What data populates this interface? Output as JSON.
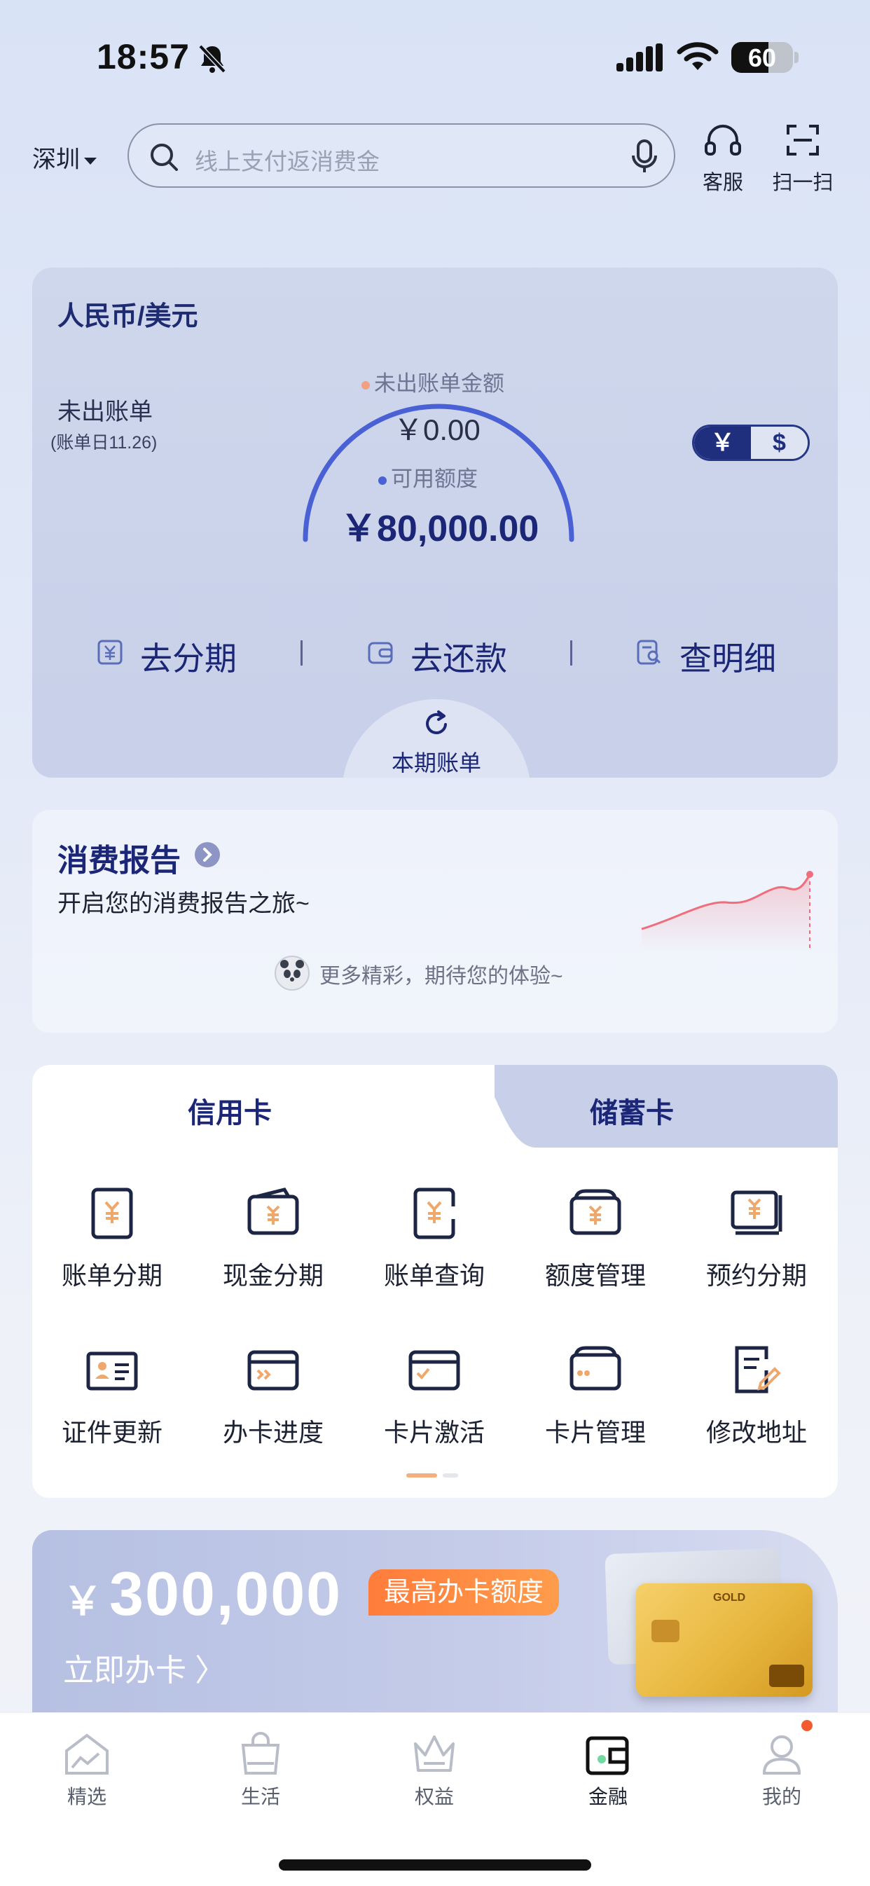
{
  "status_bar": {
    "time": "18:57",
    "battery": "60"
  },
  "header": {
    "city": "深圳",
    "search_placeholder": "线上支付返消费金",
    "service_label": "客服",
    "scan_label": "扫一扫"
  },
  "bill_panel": {
    "currency": "人民币/美元",
    "unbilled_label": "未出账单",
    "bill_day": "(账单日11.26)",
    "unbilled_amount_label": "未出账单金额",
    "unbilled_amount": "￥0.00",
    "available_label": "可用额度",
    "available_amount": "￥80,000.00",
    "toggle_cny": "￥",
    "toggle_usd": "$",
    "actions": [
      {
        "label": "去分期",
        "icon": "yuan-doc-icon"
      },
      {
        "label": "去还款",
        "icon": "wallet-icon"
      },
      {
        "label": "查明细",
        "icon": "detail-search-icon"
      }
    ],
    "current_bill_label": "本期账单",
    "colors": {
      "accent": "#1c2676",
      "gauge": "#4a61d6"
    }
  },
  "report": {
    "title": "消费报告",
    "subtitle": "开启您的消费报告之旅~",
    "more_text": "更多精彩，期待您的体验~"
  },
  "menu": {
    "tabs": [
      {
        "label": "信用卡",
        "active": true
      },
      {
        "label": "储蓄卡",
        "active": false
      }
    ],
    "items": [
      {
        "label": "账单分期",
        "icon": "bill-installment-icon"
      },
      {
        "label": "现金分期",
        "icon": "cash-installment-icon"
      },
      {
        "label": "账单查询",
        "icon": "bill-query-icon"
      },
      {
        "label": "额度管理",
        "icon": "limit-management-icon"
      },
      {
        "label": "预约分期",
        "icon": "reserve-installment-icon"
      },
      {
        "label": "证件更新",
        "icon": "id-card-icon"
      },
      {
        "label": "办卡进度",
        "icon": "card-progress-icon"
      },
      {
        "label": "卡片激活",
        "icon": "card-activate-icon"
      },
      {
        "label": "卡片管理",
        "icon": "card-manage-icon"
      },
      {
        "label": "修改地址",
        "icon": "edit-address-icon"
      }
    ]
  },
  "promo": {
    "currency_symbol": "￥",
    "amount": "300,000",
    "tag": "最高办卡额度",
    "apply": "立即办卡 〉",
    "card_text": "GOLD"
  },
  "bottom_nav": [
    {
      "label": "精选",
      "active": false
    },
    {
      "label": "生活",
      "active": false
    },
    {
      "label": "权益",
      "active": false
    },
    {
      "label": "金融",
      "active": true
    },
    {
      "label": "我的",
      "active": false
    }
  ]
}
